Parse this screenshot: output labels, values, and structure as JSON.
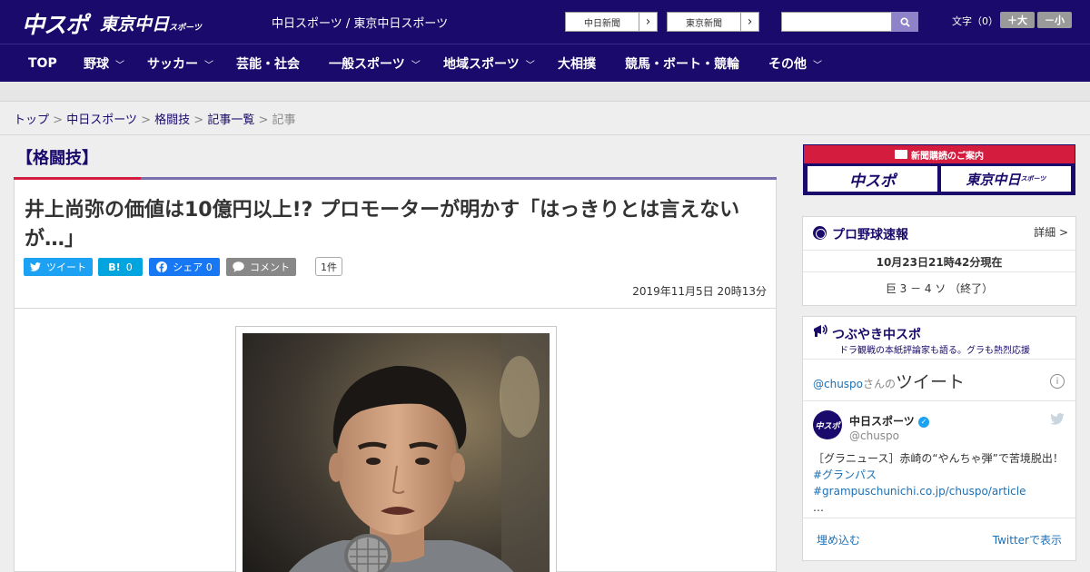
{
  "header": {
    "logo_chuspo": "中スポ",
    "logo_tokyo_main": "東京中日",
    "logo_tokyo_small": "スポーツ",
    "site_names": "中日スポーツ / 東京中日スポーツ",
    "paper_link_1": "中日新聞",
    "paper_link_2": "東京新聞",
    "search_placeholder": "",
    "font_size_label": "文字（0）",
    "font_larger": "＋大",
    "font_smaller": "－小"
  },
  "nav": {
    "items": [
      {
        "label": "TOP",
        "dropdown": false
      },
      {
        "label": "野球",
        "dropdown": true
      },
      {
        "label": "サッカー",
        "dropdown": true
      },
      {
        "label": "芸能・社会",
        "dropdown": false
      },
      {
        "label": "一般スポーツ",
        "dropdown": true
      },
      {
        "label": "地域スポーツ",
        "dropdown": true
      },
      {
        "label": "大相撲",
        "dropdown": false
      },
      {
        "label": "競馬・ボート・競輪",
        "dropdown": false
      },
      {
        "label": "その他",
        "dropdown": true
      }
    ]
  },
  "breadcrumb": {
    "items": [
      "トップ",
      "中日スポーツ",
      "格闘技",
      "記事一覧"
    ],
    "current": "記事",
    "separator": ">"
  },
  "article": {
    "category": "【格闘技】",
    "title": "井上尚弥の価値は10億円以上!? プロモーターが明かす「はっきりとは言えないが…」",
    "date": "2019年11月5日 20時13分",
    "share": {
      "tweet": "ツイート",
      "hatena_icon": "B!",
      "hatena_count": "0",
      "facebook": "シェア 0",
      "comment": "コメント",
      "comment_count": "1件"
    }
  },
  "sidebar": {
    "ad_title": "新聞購読のご案内",
    "ad_logo_1": "中スポ",
    "ad_logo_2_main": "東京中日",
    "ad_logo_2_small": "スポーツ",
    "baseball": {
      "title": "プロ野球速報",
      "detail": "詳細 >",
      "updated": "10月23日21時42分現在",
      "score": "巨 3 － 4 ソ （終了）"
    },
    "tsubuyaki": {
      "title": "つぶやき中スポ",
      "subtitle": "ドラ観戦の本紙評論家も語る。グラも熱烈応援",
      "header_prefix": "@chuspo",
      "header_suffix": "さんの",
      "header_main": "ツイート",
      "account_name": "中日スポーツ",
      "account_handle": "@chuspo",
      "avatar_text": "中スポ",
      "tweet_text": "［グラニュース］赤崎の“やんちゃ弾”で苦境脱出！",
      "tweet_links": "#グランパス #grampuschunichi.co.jp/chuspo/article",
      "ellipsis": "…",
      "embed": "埋め込む",
      "view_on_twitter": "Twitterで表示"
    }
  },
  "colors": {
    "brand_navy": "#1a0a6b",
    "accent_red": "#d41c3e",
    "twitter_blue": "#1da1f2",
    "hatena_blue": "#00a4de",
    "facebook_blue": "#1877f2",
    "comment_gray": "#888888"
  }
}
